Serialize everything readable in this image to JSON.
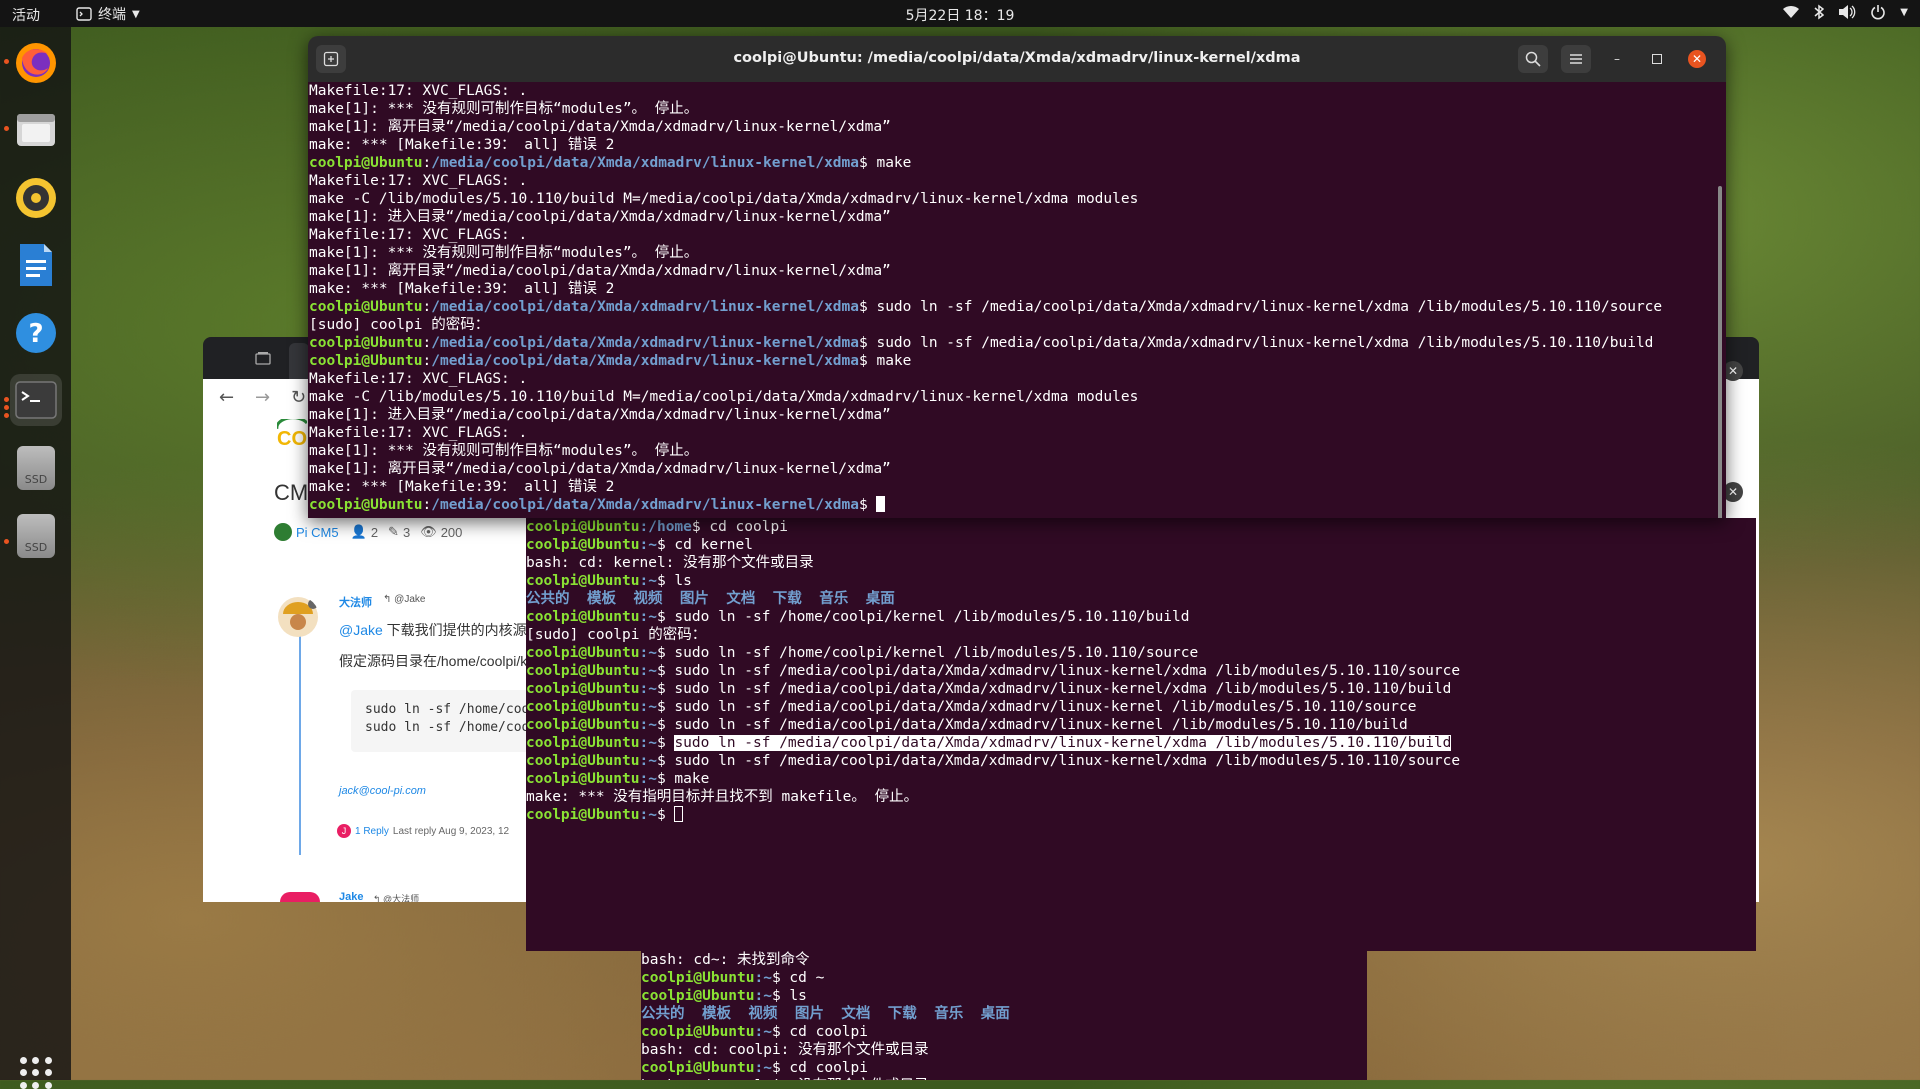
{
  "topbar": {
    "activities": "活动",
    "app_menu": "终端",
    "clock": "5月22日  18：19"
  },
  "dock": {
    "items": [
      {
        "name": "firefox-icon"
      },
      {
        "name": "files-icon"
      },
      {
        "name": "rhythmbox-icon"
      },
      {
        "name": "writer-icon"
      },
      {
        "name": "help-icon"
      },
      {
        "name": "terminal-icon"
      },
      {
        "name": "ssd-icon",
        "label": "SSD"
      },
      {
        "name": "ssd-icon",
        "label": "SSD"
      }
    ]
  },
  "main_terminal": {
    "title": "coolpi@Ubuntu: /media/coolpi/data/Xmda/xdmadrv/linux-kernel/xdma",
    "prompt_user": "coolpi@Ubuntu",
    "prompt_path": "/media/coolpi/data/Xmda/xdmadrv/linux-kernel/xdma",
    "lines": [
      {
        "t": "Makefile:17: XVC_FLAGS: ."
      },
      {
        "t": "make[1]: *** 没有规则可制作目标“modules”。 停止。"
      },
      {
        "t": "make[1]: 离开目录“/media/coolpi/data/Xmda/xdmadrv/linux-kernel/xdma”"
      },
      {
        "t": "make: *** [Makefile:39： all] 错误 2"
      },
      {
        "prompt": true,
        "cmd": " make"
      },
      {
        "t": "Makefile:17: XVC_FLAGS: ."
      },
      {
        "t": "make -C /lib/modules/5.10.110/build M=/media/coolpi/data/Xmda/xdmadrv/linux-kernel/xdma modules"
      },
      {
        "t": "make[1]: 进入目录“/media/coolpi/data/Xmda/xdmadrv/linux-kernel/xdma”"
      },
      {
        "t": "Makefile:17: XVC_FLAGS: ."
      },
      {
        "t": "make[1]: *** 没有规则可制作目标“modules”。 停止。"
      },
      {
        "t": "make[1]: 离开目录“/media/coolpi/data/Xmda/xdmadrv/linux-kernel/xdma”"
      },
      {
        "t": "make: *** [Makefile:39： all] 错误 2"
      },
      {
        "prompt": true,
        "cmd": " sudo ln -sf /media/coolpi/data/Xmda/xdmadrv/linux-kernel/xdma /lib/modules/5.10.110/source"
      },
      {
        "t": "[sudo] coolpi 的密码："
      },
      {
        "prompt": true,
        "cmd": " sudo ln -sf /media/coolpi/data/Xmda/xdmadrv/linux-kernel/xdma /lib/modules/5.10.110/build"
      },
      {
        "prompt": true,
        "cmd": " make"
      },
      {
        "t": "Makefile:17: XVC_FLAGS: ."
      },
      {
        "t": "make -C /lib/modules/5.10.110/build M=/media/coolpi/data/Xmda/xdmadrv/linux-kernel/xdma modules"
      },
      {
        "t": "make[1]: 进入目录“/media/coolpi/data/Xmda/xdmadrv/linux-kernel/xdma”"
      },
      {
        "t": "Makefile:17: XVC_FLAGS: ."
      },
      {
        "t": "make[1]: *** 没有规则可制作目标“modules”。 停止。"
      },
      {
        "t": "make[1]: 离开目录“/media/coolpi/data/Xmda/xdmadrv/linux-kernel/xdma”"
      },
      {
        "t": "make: *** [Makefile:39： all] 错误 2"
      },
      {
        "prompt": true,
        "cmd": " ",
        "cursor": true
      }
    ]
  },
  "second_terminal": {
    "lines": [
      {
        "u": "coolpi@Ubuntu",
        "p": ":/home",
        "cmd": "$ cd coolpi"
      },
      {
        "u": "coolpi@Ubuntu",
        "p": ":~",
        "cmd": "$ cd kernel"
      },
      {
        "t": "bash: cd: kernel: 没有那个文件或目录"
      },
      {
        "u": "coolpi@Ubuntu",
        "p": ":~",
        "cmd": "$ ls"
      },
      {
        "dirs": "公共的  模板  视频  图片  文档  下载  音乐  桌面"
      },
      {
        "u": "coolpi@Ubuntu",
        "p": ":~",
        "cmd": "$ sudo ln -sf /home/coolpi/kernel /lib/modules/5.10.110/build"
      },
      {
        "t": "[sudo] coolpi 的密码："
      },
      {
        "u": "coolpi@Ubuntu",
        "p": ":~",
        "cmd": "$ sudo ln -sf /home/coolpi/kernel /lib/modules/5.10.110/source"
      },
      {
        "u": "coolpi@Ubuntu",
        "p": ":~",
        "cmd": "$ sudo ln -sf /media/coolpi/data/Xmda/xdmadrv/linux-kernel/xdma /lib/modules/5.10.110/source"
      },
      {
        "u": "coolpi@Ubuntu",
        "p": ":~",
        "cmd": "$ sudo ln -sf /media/coolpi/data/Xmda/xdmadrv/linux-kernel/xdma /lib/modules/5.10.110/build"
      },
      {
        "u": "coolpi@Ubuntu",
        "p": ":~",
        "cmd": "$ sudo ln -sf /media/coolpi/data/Xmda/xdmadrv/linux-kernel /lib/modules/5.10.110/source"
      },
      {
        "u": "coolpi@Ubuntu",
        "p": ":~",
        "cmd": "$ sudo ln -sf /media/coolpi/data/Xmda/xdmadrv/linux-kernel /lib/modules/5.10.110/build"
      },
      {
        "u": "coolpi@Ubuntu",
        "p": ":~",
        "cmd": "$ ",
        "hl": "sudo ln -sf /media/coolpi/data/Xmda/xdmadrv/linux-kernel/xdma /lib/modules/5.10.110/build"
      },
      {
        "u": "coolpi@Ubuntu",
        "p": ":~",
        "cmd": "$ sudo ln -sf /media/coolpi/data/Xmda/xdmadrv/linux-kernel/xdma /lib/modules/5.10.110/source"
      },
      {
        "u": "coolpi@Ubuntu",
        "p": ":~",
        "cmd": "$ make"
      },
      {
        "t": "make: *** 没有指明目标并且找不到 makefile。 停止。"
      },
      {
        "u": "coolpi@Ubuntu",
        "p": ":~",
        "cmd": "$ ",
        "cursor": true
      }
    ]
  },
  "third_terminal": {
    "lines": [
      {
        "t": "bash: cd~: 未找到命令"
      },
      {
        "u": "coolpi@Ubuntu",
        "p": ":~",
        "cmd": "$ cd ~"
      },
      {
        "u": "coolpi@Ubuntu",
        "p": ":~",
        "cmd": "$ ls"
      },
      {
        "dirs": "公共的  模板  视频  图片  文档  下载  音乐  桌面"
      },
      {
        "u": "coolpi@Ubuntu",
        "p": ":~",
        "cmd": "$ cd coolpi"
      },
      {
        "t": "bash: cd: coolpi: 没有那个文件或目录"
      },
      {
        "u": "coolpi@Ubuntu",
        "p": ":~",
        "cmd": "$ cd coolpi"
      },
      {
        "t": "bash: cd: coolpi: 没有那个文件或目录"
      }
    ]
  },
  "browser": {
    "heading": "CM",
    "category": "Pi CM5",
    "stats": {
      "users": "2",
      "posts": "3",
      "views": "200"
    },
    "post": {
      "author": "大法师",
      "reply_to": "@Jake",
      "mention": "@Jake",
      "text1": " 下载我们提供的内核源",
      "text2": "假定源码目录在/home/coolpi/k",
      "code1": "sudo ln -sf /home/coo",
      "code2": "sudo ln -sf /home/coo",
      "email": "jack@cool-pi.com",
      "reply_avatar": "J",
      "reply_count": "1 Reply",
      "last_reply": " Last reply Aug 9, 2023, 12"
    },
    "next_author": "Jake",
    "next_reply_to": "@大法师"
  },
  "colors": {
    "terminal_bg": "#300a24",
    "prompt_user": "#8ae234",
    "prompt_path": "#729fcf",
    "accent": "#e95420"
  }
}
